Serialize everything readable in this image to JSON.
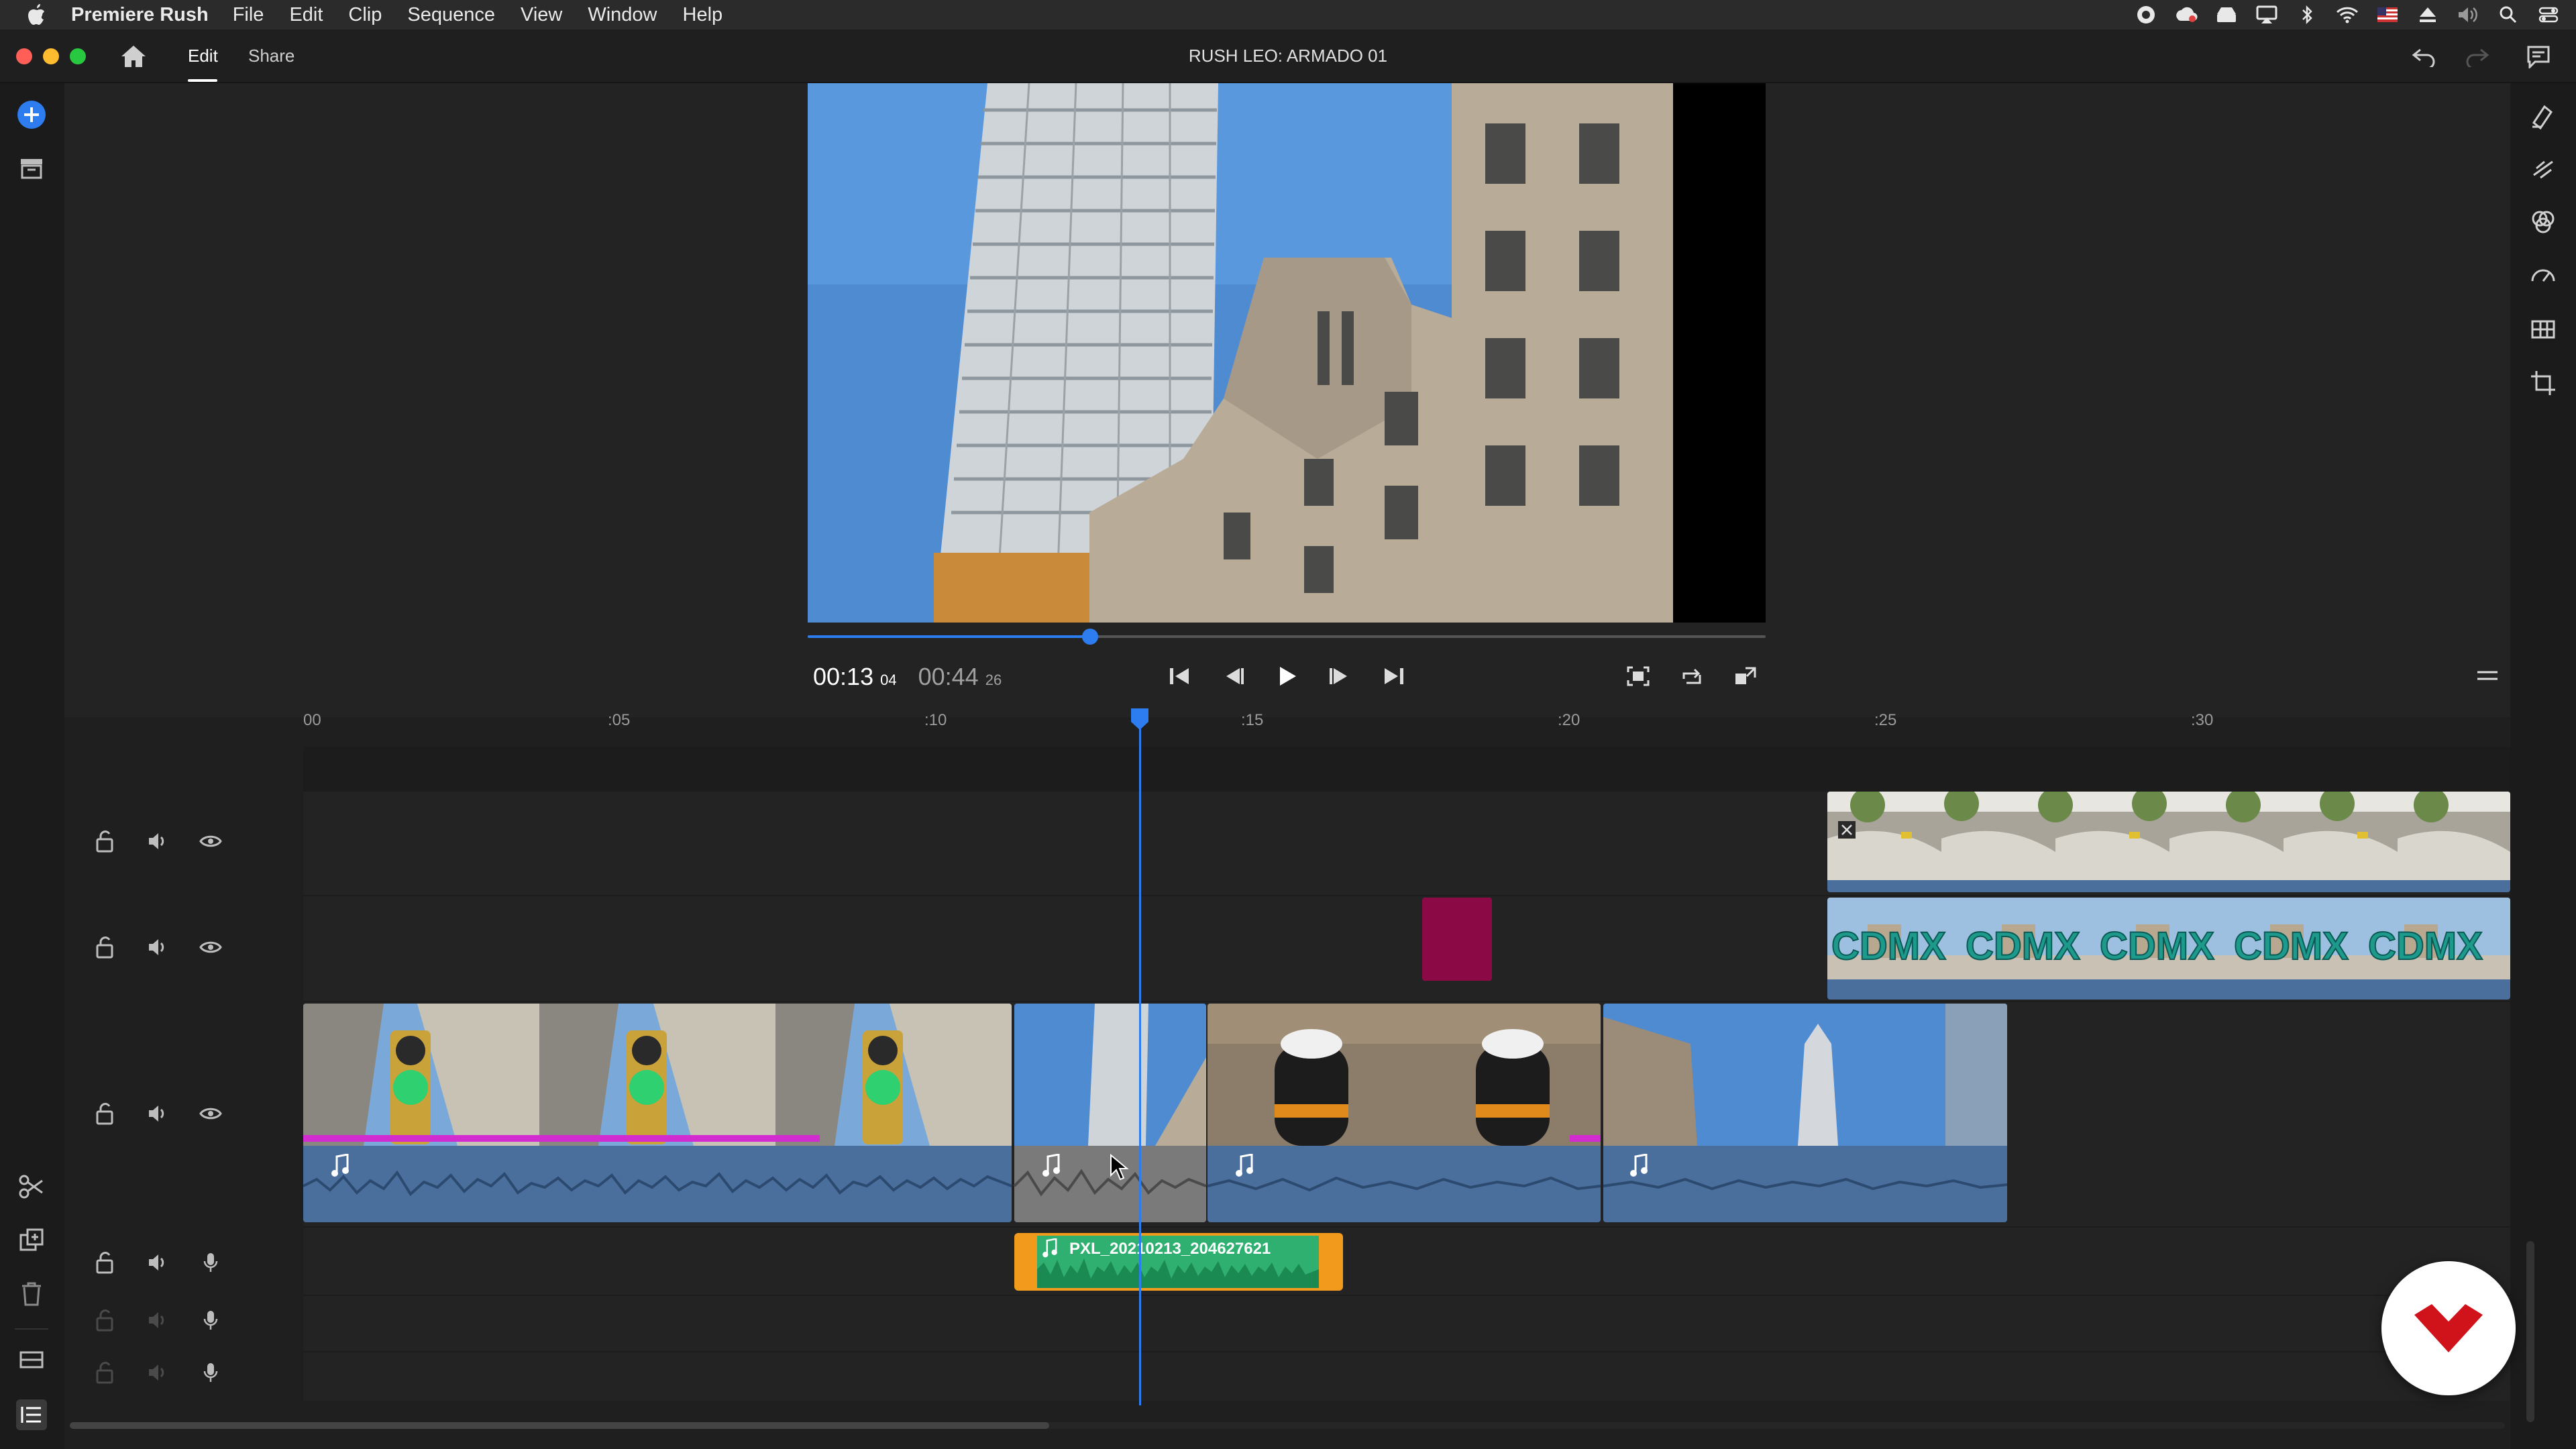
{
  "menubar": {
    "app_name": "Premiere Rush",
    "menus": [
      "File",
      "Edit",
      "Clip",
      "Sequence",
      "View",
      "Window",
      "Help"
    ]
  },
  "header": {
    "tabs": [
      "Edit",
      "Share"
    ],
    "active_tab": "Edit",
    "project_title": "RUSH LEO: ARMADO 01"
  },
  "player": {
    "current_time": "00:13",
    "current_frames": "04",
    "duration": "00:44",
    "duration_frames": "26",
    "scrub_fraction": 0.295
  },
  "timeline": {
    "ruler_labels": [
      "00",
      ":05",
      ":10",
      ":15",
      ":20",
      ":25",
      ":30"
    ],
    "audio_clip_name": "PXL_20210213_204627621"
  },
  "colors": {
    "accent": "#2d7df0",
    "title_card": "#8b0a45",
    "audio_clip": "#f29a1c",
    "audio_inner": "#2fb070",
    "waveform": "#4a6f9c",
    "watermark_logo": "#d0121b"
  },
  "icons": {
    "add_media": "plus-circle-icon",
    "project_panel": "archive-icon",
    "split": "scissors-icon",
    "duplicate": "duplicate-icon",
    "delete": "trash-icon",
    "track_controls": "track-controls-icon",
    "timeline_menu": "list-icon"
  }
}
